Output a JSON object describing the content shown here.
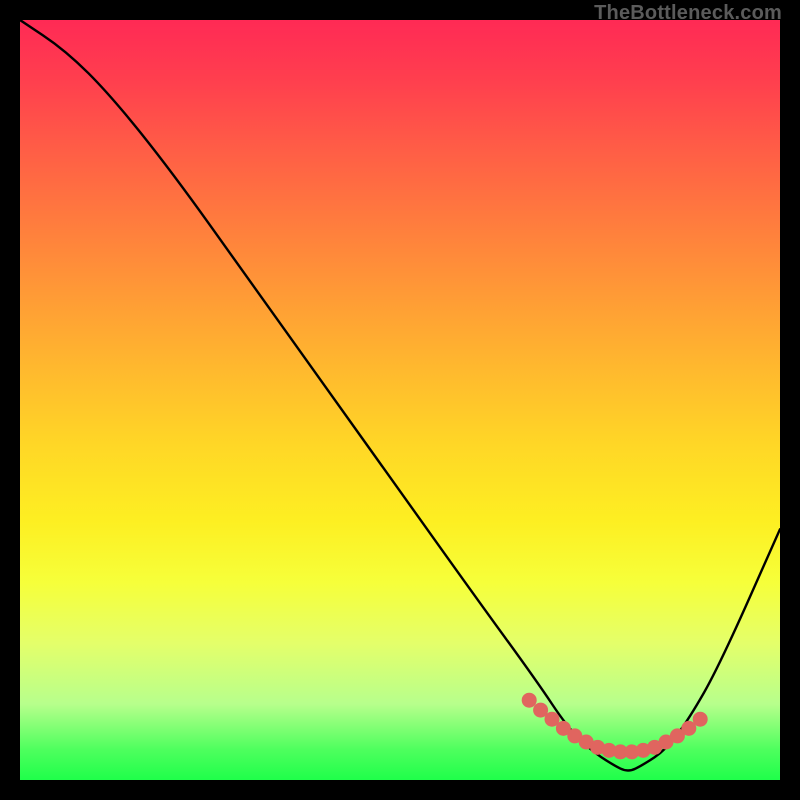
{
  "watermark": "TheBottleneck.com",
  "chart_data": {
    "type": "line",
    "title": "",
    "xlabel": "",
    "ylabel": "",
    "xlim": [
      0,
      100
    ],
    "ylim": [
      0,
      100
    ],
    "grid": false,
    "legend": false,
    "series": [
      {
        "name": "curve",
        "color": "#000000",
        "x": [
          0,
          6,
          12,
          20,
          30,
          40,
          50,
          60,
          68,
          72,
          75,
          78,
          80,
          82,
          85,
          88,
          92,
          100
        ],
        "values": [
          100,
          96,
          90,
          80,
          66,
          52,
          38,
          24,
          13,
          7,
          4,
          2,
          1,
          2,
          4,
          8,
          15,
          33
        ]
      },
      {
        "name": "markers",
        "color": "#e0655f",
        "type": "scatter",
        "x": [
          67,
          68.5,
          70,
          71.5,
          73,
          74.5,
          76,
          77.5,
          79,
          80.5,
          82,
          83.5,
          85,
          86.5,
          88,
          89.5
        ],
        "values": [
          10.5,
          9.2,
          8.0,
          6.8,
          5.8,
          5.0,
          4.3,
          3.9,
          3.7,
          3.7,
          3.9,
          4.3,
          5.0,
          5.8,
          6.8,
          8.0
        ]
      }
    ]
  }
}
